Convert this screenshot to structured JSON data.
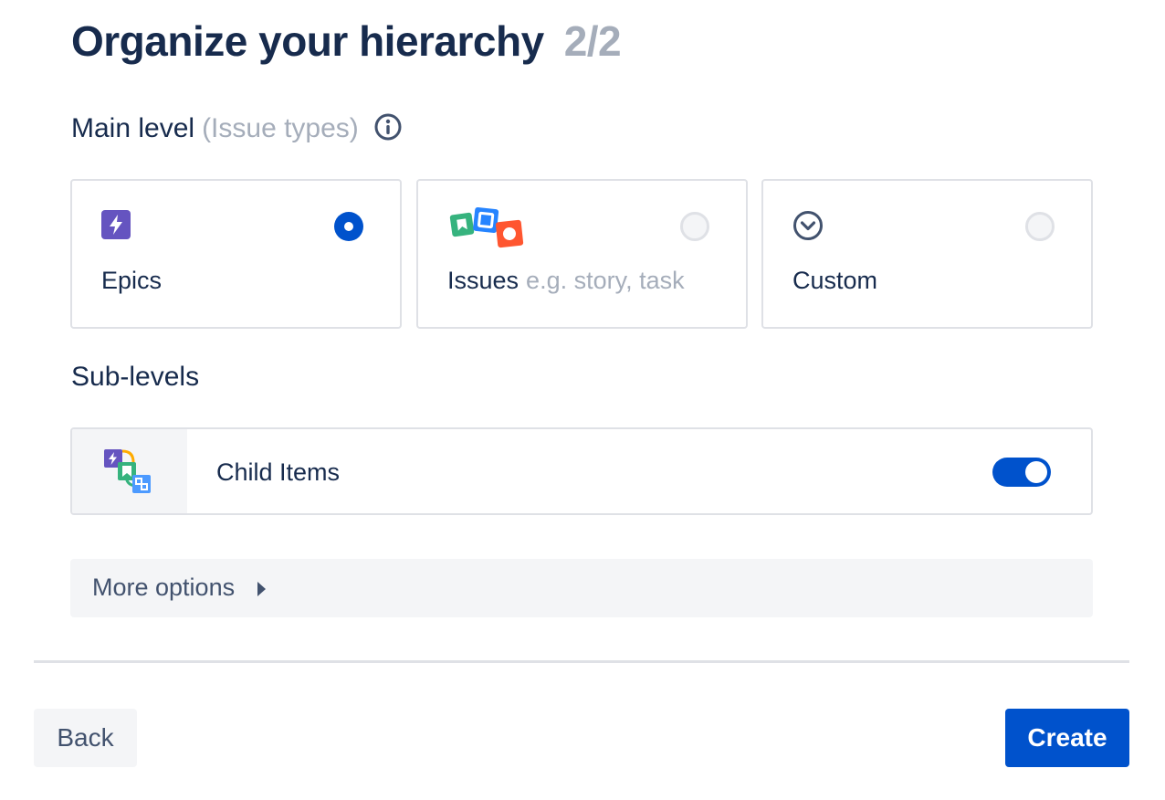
{
  "header": {
    "title": "Organize your hierarchy",
    "step": "2/2"
  },
  "main_level": {
    "label": "Main level",
    "sublabel": "(Issue types)",
    "info_icon": "info-icon",
    "options": [
      {
        "label": "Epics",
        "hint": "",
        "icon": "epic-icon",
        "selected": true
      },
      {
        "label": "Issues",
        "hint": "e.g. story, task",
        "icon": "issue-types-icon",
        "selected": false
      },
      {
        "label": "Custom",
        "hint": "",
        "icon": "chevron-circle-icon",
        "selected": false
      }
    ]
  },
  "sub_levels": {
    "label": "Sub-levels",
    "item": {
      "label": "Child Items",
      "icon": "child-items-icon",
      "enabled": true
    }
  },
  "more_options": {
    "label": "More options",
    "icon": "caret-right-icon"
  },
  "footer": {
    "back_label": "Back",
    "create_label": "Create"
  },
  "colors": {
    "primary": "#0052cc",
    "text": "#172b4d",
    "muted": "#a5adba",
    "epic": "#6554c0",
    "story": "#36b37e",
    "task": "#2684ff",
    "bug": "#ff5630"
  }
}
